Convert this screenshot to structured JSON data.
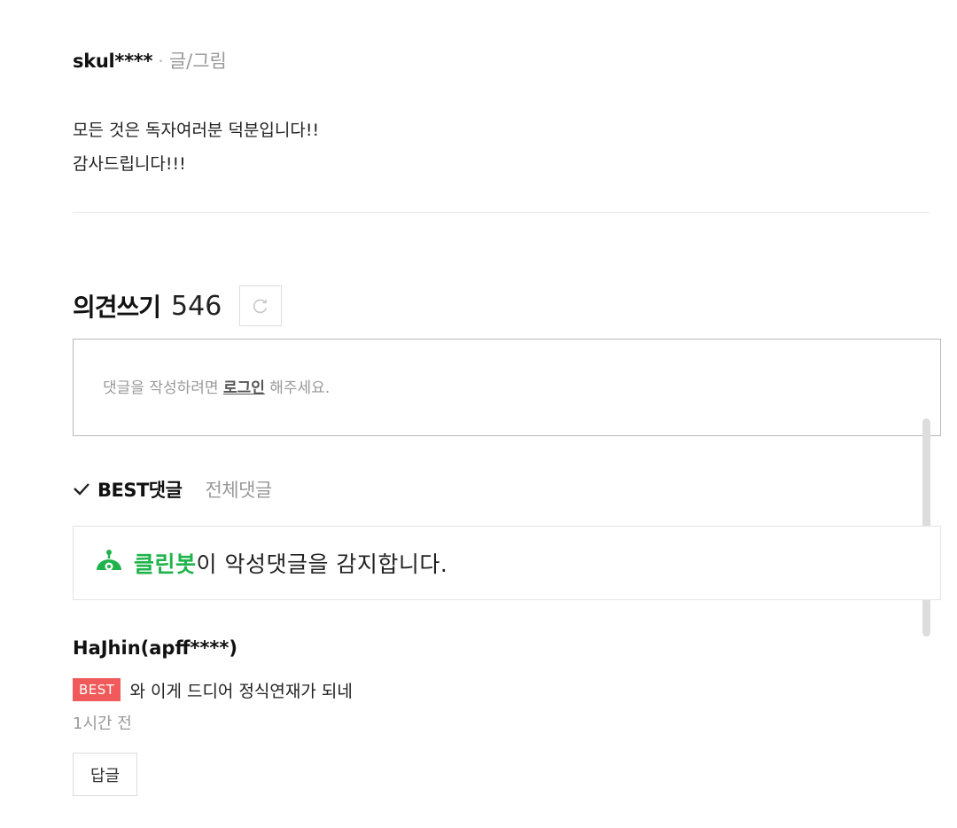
{
  "author": {
    "name": "skul****",
    "separator": "·",
    "role": "글/그림",
    "message_lines": [
      "모든 것은 독자여러분 덕분입니다!!",
      "감사드립니다!!!"
    ]
  },
  "comments": {
    "title": "의견쓰기",
    "count": "546",
    "refresh_icon": "refresh-icon",
    "input": {
      "prefix": "댓글을 작성하려면 ",
      "login_link": "로그인",
      "suffix": " 해주세요."
    },
    "tabs": {
      "best": "BEST댓글",
      "all": "전체댓글"
    },
    "cleanbot": {
      "icon": "cleanbot-icon",
      "name": "클린봇",
      "text": "이 악성댓글을 감지합니다."
    },
    "items": [
      {
        "author": "HaJhin(apff****)",
        "badge": "BEST",
        "text": "와 이게 드디어 정식연재가 되네",
        "time": "1시간 전",
        "reply_label": "답글"
      }
    ]
  },
  "colors": {
    "cleanbot_green": "#20b34b",
    "best_badge": "#f05a5a"
  }
}
